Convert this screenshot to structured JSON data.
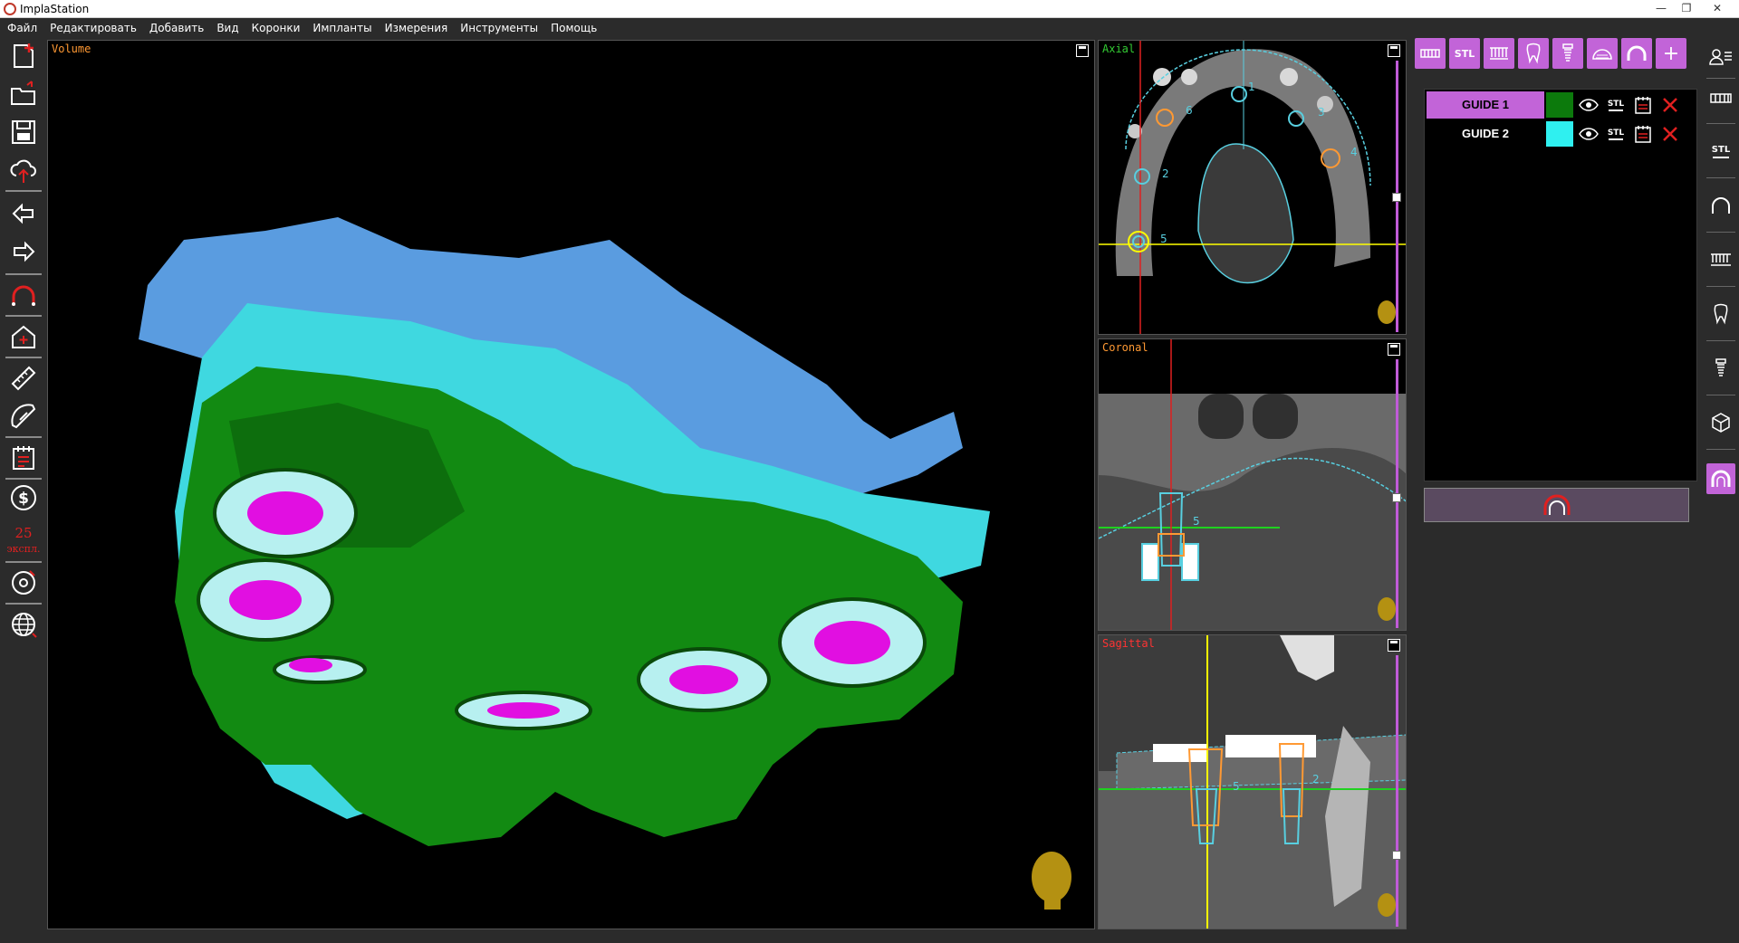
{
  "window": {
    "title": "ImplaStation",
    "minimize": "—",
    "maximize": "❐",
    "close": "✕"
  },
  "menu": [
    "Файл",
    "Редактировать",
    "Добавить",
    "Вид",
    "Коронки",
    "Импланты",
    "Измерения",
    "Инструменты",
    "Помощь"
  ],
  "left_toolbar": {
    "credits_count": "25",
    "credits_unit": "экспл.",
    "icons": [
      "new-case-icon",
      "open-folder-icon",
      "save-icon",
      "cloud-upload-icon",
      "undo-arrow-icon",
      "redo-arrow-icon",
      "arch-curve-icon",
      "home-view-icon",
      "ruler-icon",
      "protractor-icon",
      "report-icon",
      "dollar-icon",
      "disc-icon",
      "globe-icon"
    ]
  },
  "viewports": {
    "volume": {
      "label": "Volume",
      "label_color": "#ff9933"
    },
    "axial": {
      "label": "Axial",
      "label_color": "#33cc33",
      "implants": [
        "1",
        "2",
        "3",
        "4",
        "5",
        "6"
      ]
    },
    "coronal": {
      "label": "Coronal",
      "label_color": "#ff9933",
      "implant": "5"
    },
    "sagittal": {
      "label": "Sagittal",
      "label_color": "#ff3333",
      "implants": [
        "5",
        "2"
      ]
    }
  },
  "right_panel": {
    "top_buttons": [
      "teeth-icon",
      "stl-icon",
      "arch-teeth-icon",
      "tooth-icon",
      "implant-icon",
      "guide-icon",
      "arch-icon",
      "plus-icon"
    ],
    "stl_label": "STL",
    "plus_label": "+",
    "guides": [
      {
        "name": "GUIDE 1",
        "color": "#0c7a0c",
        "name_bg": "#c264d8",
        "name_color": "#000000"
      },
      {
        "name": "GUIDE 2",
        "color": "#2ff0f0",
        "name_bg": "#000000",
        "name_color": "#ffffff"
      }
    ],
    "stl_small": "STL"
  },
  "right_side_toolbar": [
    "patient-list-icon",
    "upper-teeth-icon",
    "stl-points-icon",
    "arch-line-icon",
    "dentition-icon",
    "tooth-outline-icon",
    "implant-outline-icon",
    "box-3d-icon",
    "guide-arch-icon"
  ],
  "colors": {
    "accent": "#c264d8",
    "guide1": "#0c7a0c",
    "guide2": "#2ff0f0",
    "gingiva": "#5a9ce0"
  }
}
